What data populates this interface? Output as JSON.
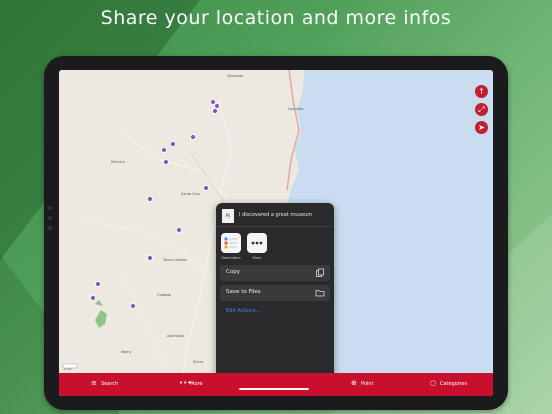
{
  "headline": "Share your location and more infos",
  "share_sheet": {
    "thumb_text": "A|",
    "message": "I discovered a great museum",
    "apps": [
      {
        "label": "Reminders",
        "icon": "reminders-icon"
      },
      {
        "label": "More",
        "icon": "more-icon"
      }
    ],
    "actions": [
      {
        "label": "Copy",
        "icon": "copy-icon"
      },
      {
        "label": "Save to Files",
        "icon": "folder-icon"
      }
    ],
    "edit_actions": "Edit Actions..."
  },
  "tab_bar": {
    "items": [
      {
        "label": "Search",
        "icon": "list-icon"
      },
      {
        "label": "More",
        "icon": "ellipsis-icon"
      },
      {
        "label": "Point",
        "icon": "plus-circle-icon"
      },
      {
        "label": "Categories",
        "icon": "circle-icon"
      }
    ]
  },
  "map": {
    "towns": [
      "Vilaverde",
      "Lourinha",
      "Peniche",
      "Santa Cruz",
      "Bombarral",
      "Torres Vedras",
      "Cadaval",
      "Azambuja",
      "Mafra",
      "Sintra"
    ],
    "scale": "5 km"
  },
  "colors": {
    "accent": "#c8102e",
    "poi": "#8b4fc8",
    "sea": "#c9dcf0"
  }
}
